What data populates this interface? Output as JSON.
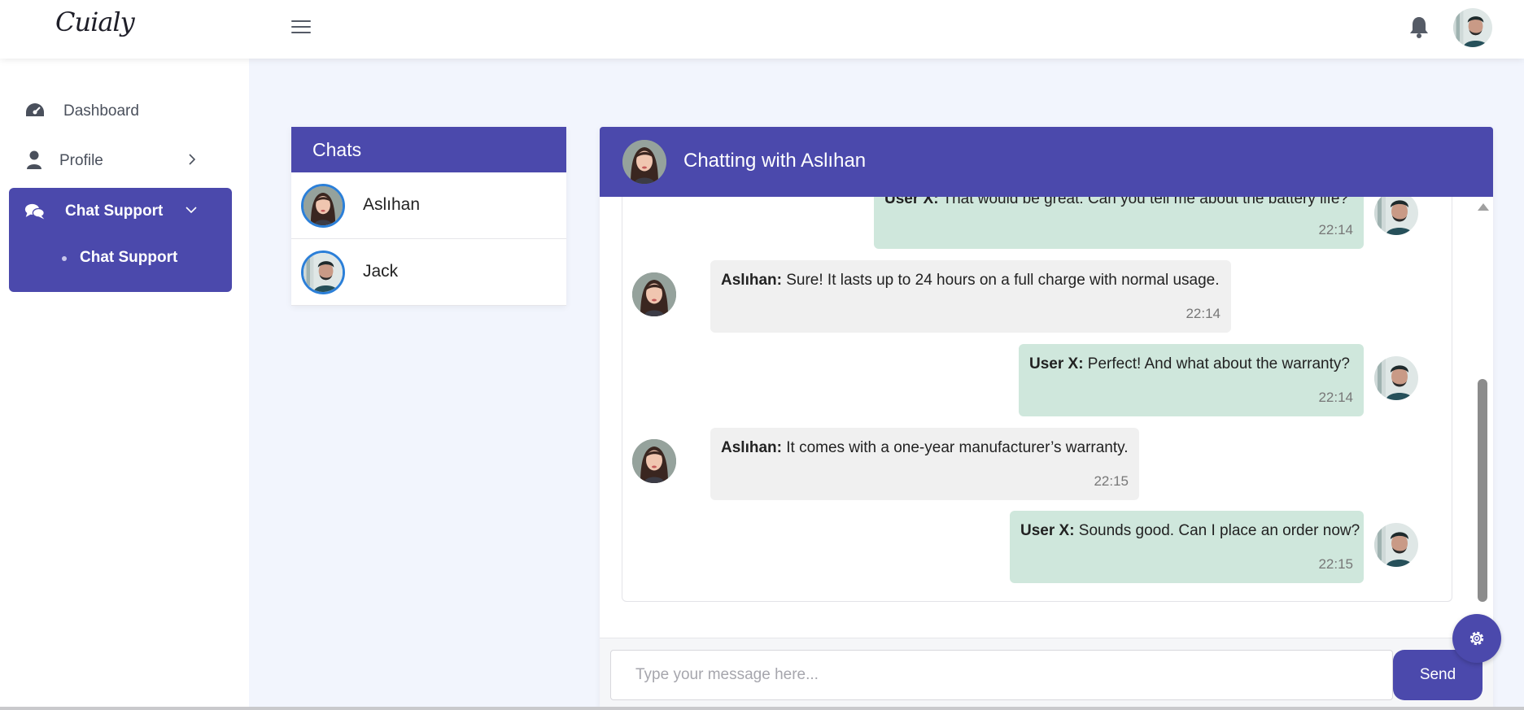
{
  "app": {
    "logo": "Cuialy"
  },
  "colors": {
    "accent": "#4b49ac",
    "outgoing_bubble": "#cfe7dc",
    "incoming_bubble": "#f0f0f0"
  },
  "sidebar": {
    "items": [
      {
        "label": "Dashboard",
        "icon": "gauge-icon"
      },
      {
        "label": "Profile",
        "icon": "user-icon"
      },
      {
        "label": "Chat Support",
        "icon": "comments-icon",
        "expanded": true,
        "children": [
          {
            "label": "Chat Support"
          }
        ]
      }
    ]
  },
  "chats": {
    "title": "Chats",
    "items": [
      {
        "name": "Aslıhan"
      },
      {
        "name": "Jack"
      }
    ]
  },
  "conversation": {
    "title": "Chatting with Aslıhan",
    "messages": [
      {
        "from": "out",
        "sender": "User X:",
        "text": " That would be great. Can you tell me about the battery life?",
        "time": "22:14"
      },
      {
        "from": "in",
        "sender": "Aslıhan:",
        "text": " Sure! It lasts up to 24 hours on a full charge with normal usage.",
        "time": "22:14"
      },
      {
        "from": "out",
        "sender": "User X:",
        "text": " Perfect! And what about the warranty?",
        "time": "22:14"
      },
      {
        "from": "in",
        "sender": "Aslıhan:",
        "text": " It comes with a one-year manufacturer’s warranty.",
        "time": "22:15"
      },
      {
        "from": "out",
        "sender": "User X:",
        "text": " Sounds good. Can I place an order now?",
        "time": "22:15"
      }
    ]
  },
  "composer": {
    "placeholder": "Type your message here...",
    "send_label": "Send"
  }
}
